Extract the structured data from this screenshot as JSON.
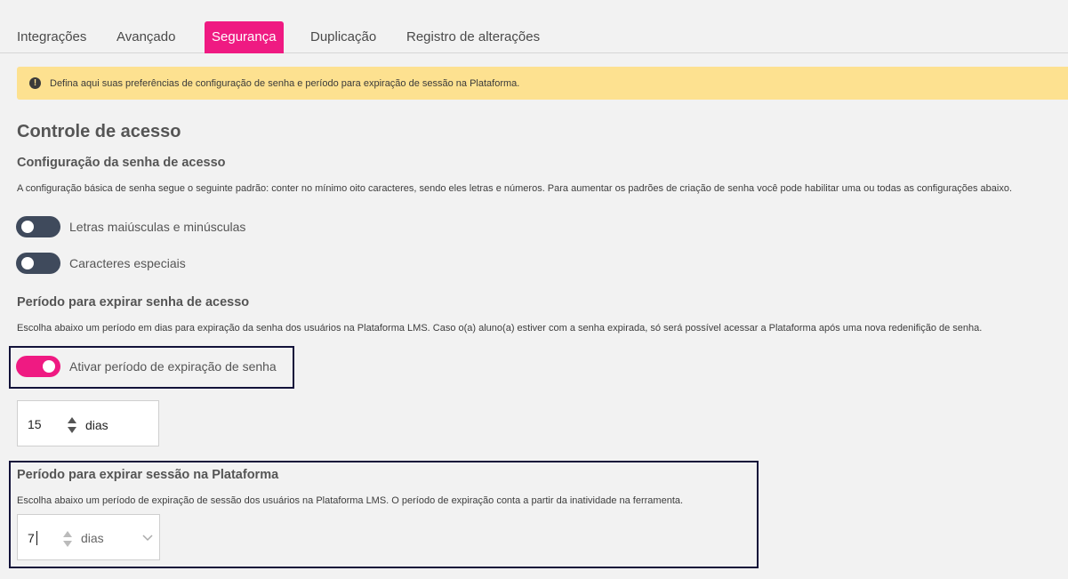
{
  "tabs": [
    {
      "label": "Integrações"
    },
    {
      "label": "Avançado"
    },
    {
      "label": "Segurança",
      "active": true
    },
    {
      "label": "Duplicação"
    },
    {
      "label": "Registro de alterações"
    }
  ],
  "alert": {
    "icon": "exclamation-circle-icon",
    "text": "Defina aqui suas preferências de configuração de senha e período para expiração de sessão na Plataforma."
  },
  "access_control": {
    "title": "Controle de acesso",
    "password_config": {
      "title": "Configuração da senha de acesso",
      "description": "A configuração básica de senha segue o seguinte padrão: conter no mínimo oito caracteres, sendo eles letras e números. Para aumentar os padrões de criação de senha você pode habilitar uma ou todas as configurações abaixo.",
      "toggles": [
        {
          "label": "Letras maiúsculas e minúsculas",
          "on": false
        },
        {
          "label": "Caracteres especiais",
          "on": false
        }
      ]
    },
    "password_expiration": {
      "title": "Período para expirar senha de acesso",
      "description": "Escolha abaixo um período em dias para expiração da senha dos usuários na Plataforma LMS. Caso o(a) aluno(a) estiver com a senha expirada, só será possível acessar a Plataforma após uma nova redenifição de senha.",
      "toggle": {
        "label": "Ativar período de expiração de senha",
        "on": true
      },
      "value": "15",
      "unit": "dias"
    },
    "session_expiration": {
      "title": "Período para expirar sessão na Plataforma",
      "description": "Escolha abaixo um período de expiração de sessão dos usuários na Plataforma LMS. O período de expiração conta a partir da inatividade na ferramenta.",
      "value": "7",
      "unit": "dias"
    }
  },
  "colors": {
    "accent": "#ef1a82",
    "alert_bg": "#fde190",
    "toggle_off": "#3f4a5c",
    "highlight_border": "#12123a"
  }
}
